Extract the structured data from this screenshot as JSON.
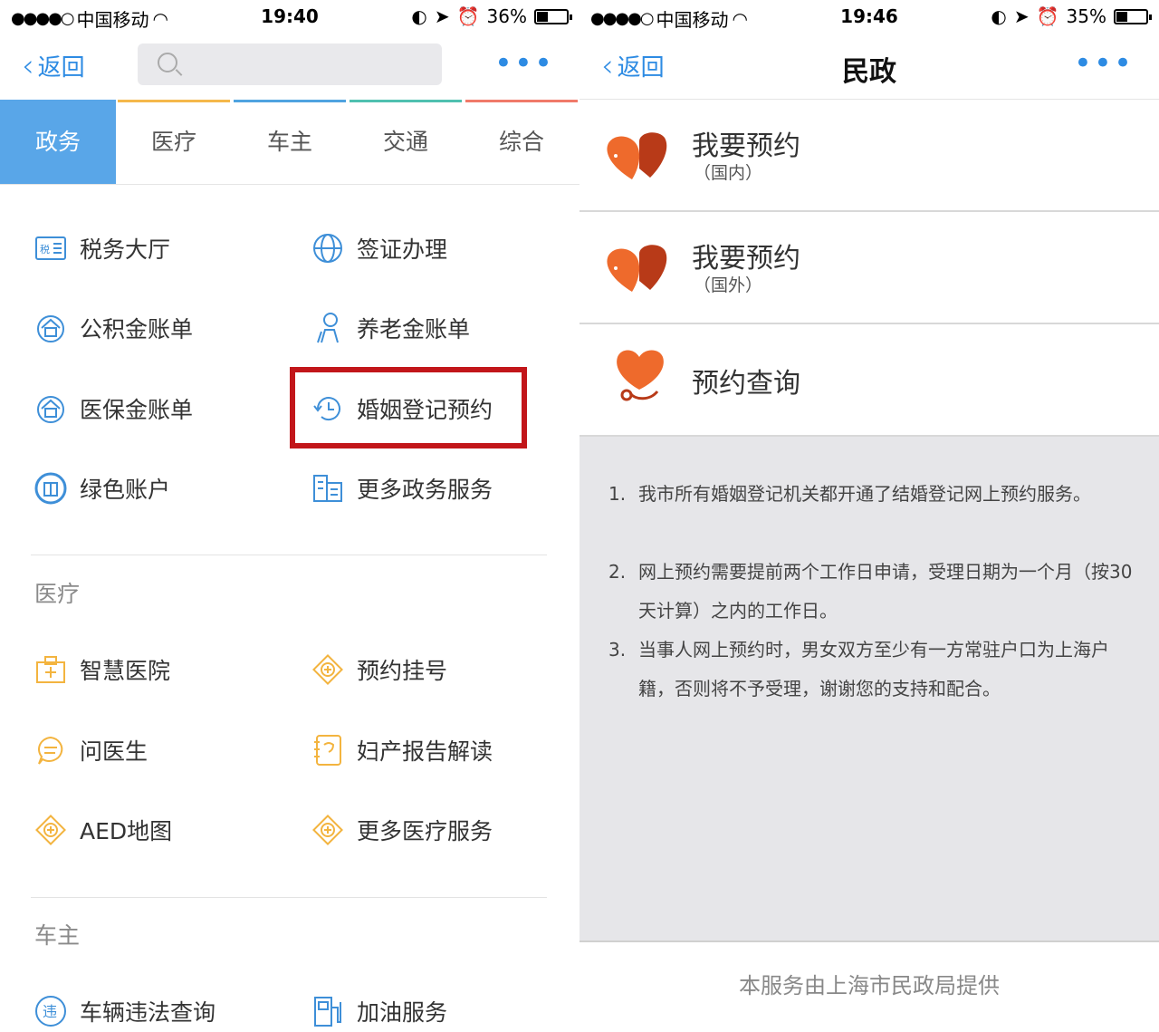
{
  "left": {
    "status": {
      "carrier": "中国移动",
      "time": "19:40",
      "battery": "36%",
      "battery_level": 0.36
    },
    "nav": {
      "back_label": "返回"
    },
    "tabs": [
      {
        "label": "政务",
        "color": "#59a6e8"
      },
      {
        "label": "医疗",
        "color": "#f5b84b"
      },
      {
        "label": "车主",
        "color": "#4fa3e0"
      },
      {
        "label": "交通",
        "color": "#4fc0b0"
      },
      {
        "label": "综合",
        "color": "#f07a6a"
      }
    ],
    "gov_items": [
      "税务大厅",
      "签证办理",
      "公积金账单",
      "养老金账单",
      "医保金账单",
      "婚姻登记预约",
      "绿色账户",
      "更多政务服务"
    ],
    "medical_label": "医疗",
    "medical_items": [
      "智慧医院",
      "预约挂号",
      "问医生",
      "妇产报告解读",
      "AED地图",
      "更多医疗服务"
    ],
    "car_label": "车主",
    "car_items": [
      "车辆违法查询",
      "加油服务"
    ],
    "highlight_color": "#c2161a"
  },
  "right": {
    "status": {
      "carrier": "中国移动",
      "time": "19:46",
      "battery": "35%",
      "battery_level": 0.35
    },
    "nav": {
      "back_label": "返回",
      "title": "民政"
    },
    "rows": [
      {
        "title": "我要预约",
        "sub": "（国内）"
      },
      {
        "title": "我要预约",
        "sub": "（国外）"
      },
      {
        "title": "预约查询"
      }
    ],
    "notes": [
      {
        "num": "1.",
        "text": "我市所有婚姻登记机关都开通了结婚登记网上预约服务。"
      },
      {
        "num": "2.",
        "text": "网上预约需要提前两个工作日申请，受理日期为一个月（按30天计算）之内的工作日。"
      },
      {
        "num": "3.",
        "text": "当事人网上预约时，男女双方至少有一方常驻户口为上海户籍，否则将不予受理，谢谢您的支持和配合。"
      }
    ],
    "footer": "本服务由上海市民政局提供"
  }
}
